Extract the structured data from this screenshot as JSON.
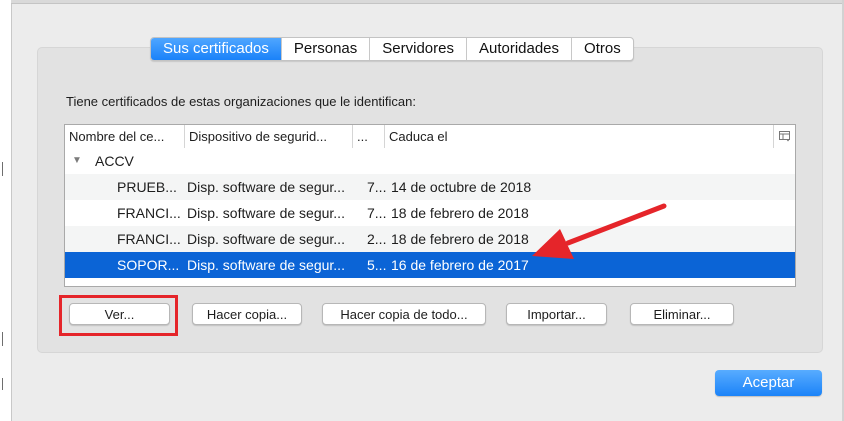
{
  "tabs": [
    {
      "label": "Sus certificados",
      "active": true
    },
    {
      "label": "Personas",
      "active": false
    },
    {
      "label": "Servidores",
      "active": false
    },
    {
      "label": "Autoridades",
      "active": false
    },
    {
      "label": "Otros",
      "active": false
    }
  ],
  "intro_text": "Tiene certificados de estas organizaciones que le identifican:",
  "table": {
    "columns": [
      "Nombre del ce...",
      "Dispositivo de segurid...",
      "...",
      "Caduca el"
    ],
    "column_picker_icon": "columns-icon",
    "group": {
      "label": "ACCV",
      "expanded": true
    },
    "rows": [
      {
        "name": "PRUEB...",
        "device": "Disp. software de segur...",
        "serial": "7...",
        "expires": "14 de octubre de 2018",
        "selected": false
      },
      {
        "name": "FRANCI...",
        "device": "Disp. software de segur...",
        "serial": "7...",
        "expires": "18 de febrero de 2018",
        "selected": false
      },
      {
        "name": "FRANCI...",
        "device": "Disp. software de segur...",
        "serial": "2...",
        "expires": "18 de febrero de 2018",
        "selected": false
      },
      {
        "name": "SOPOR...",
        "device": "Disp. software de segur...",
        "serial": "5...",
        "expires": "16 de febrero de 2017",
        "selected": true
      }
    ]
  },
  "buttons": {
    "view": "Ver...",
    "backup": "Hacer copia...",
    "backup_all": "Hacer copia de todo...",
    "import": "Importar...",
    "delete": "Eliminar..."
  },
  "accept_label": "Aceptar",
  "colors": {
    "accent": "#1a82f9",
    "selection": "#0b64d6",
    "annotation": "#e5252a"
  }
}
